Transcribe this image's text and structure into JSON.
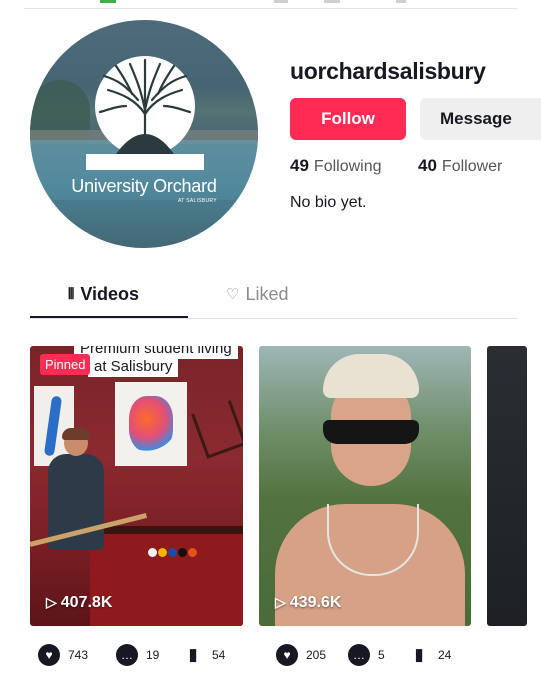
{
  "profile": {
    "avatar_brand": "University Orchard",
    "avatar_brand_sub": "AT SALISBURY",
    "username": "uorchardsalisbury",
    "follow_label": "Follow",
    "message_label": "Message",
    "following_count": "49",
    "following_label": "Following",
    "followers_count": "40",
    "followers_label": "Follower",
    "bio": "No bio yet."
  },
  "tabs": [
    {
      "label": "Videos",
      "icon": "grid-icon",
      "active": true
    },
    {
      "label": "Liked",
      "icon": "heart-lock-icon",
      "active": false
    }
  ],
  "videos": [
    {
      "caption_top": "Premium student living",
      "caption": "at Salisbury",
      "pinned_label": "Pinned",
      "views": "407.8K",
      "likes": "743",
      "comments": "19",
      "saves": "54"
    },
    {
      "views": "439.6K",
      "likes": "205",
      "comments": "5",
      "saves": "24"
    }
  ],
  "colors": {
    "accent": "#fe2c55",
    "text": "#161823",
    "muted": "#8a8b91",
    "button_secondary": "#efefef"
  }
}
